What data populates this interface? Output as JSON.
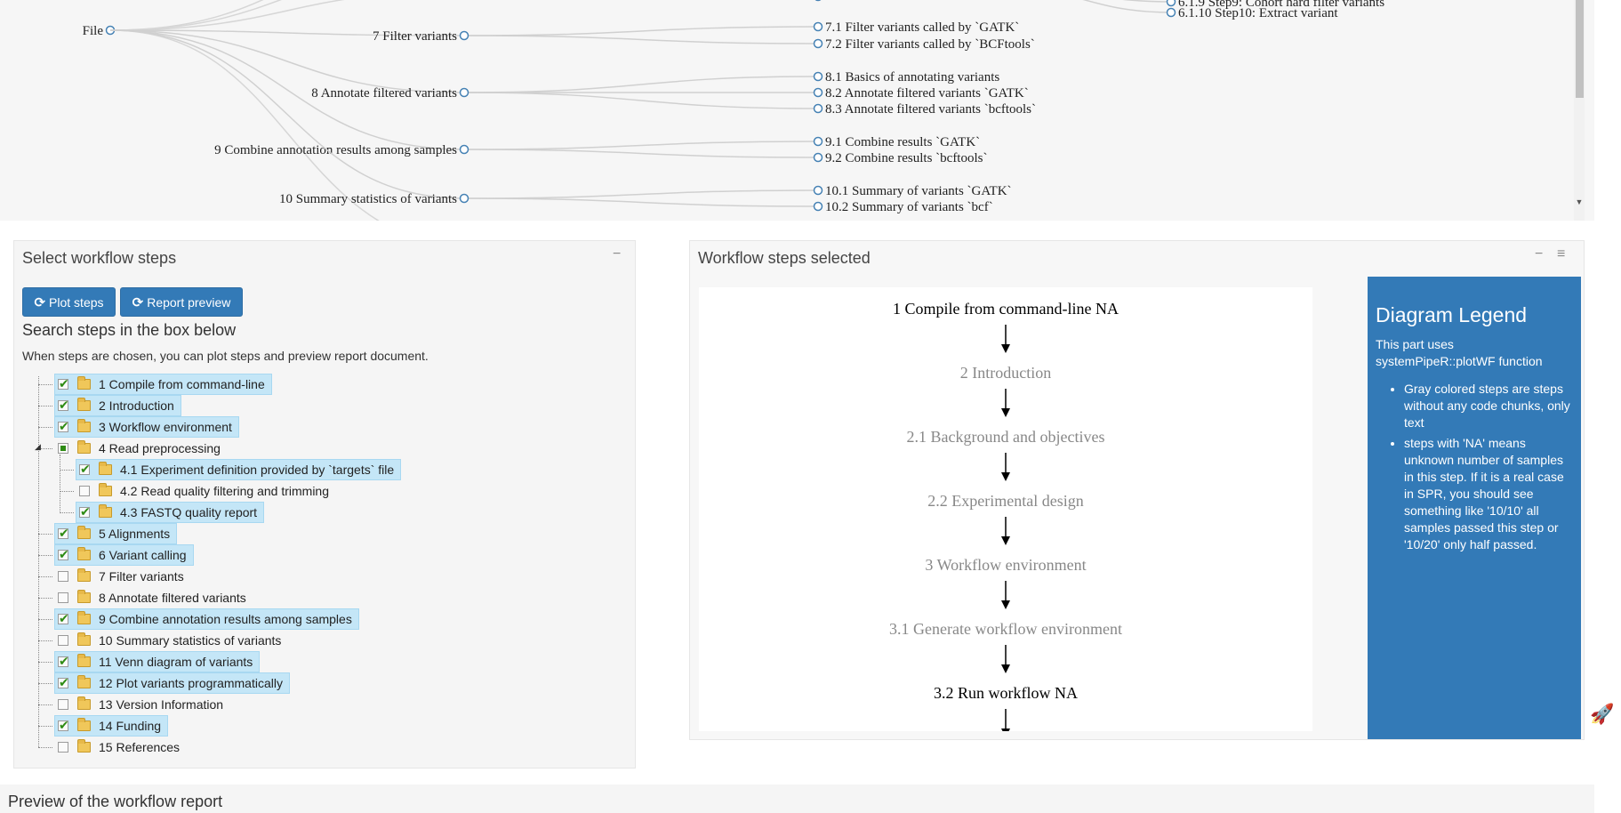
{
  "tree_plot": {
    "root": "File",
    "branches": [
      {
        "label": "7 Filter variants",
        "children": [
          "7.1 Filter variants called by `GATK`",
          "7.2 Filter variants called by `BCFtools`"
        ]
      },
      {
        "label": "8 Annotate filtered variants",
        "children": [
          "8.1 Basics of annotating variants",
          "8.2 Annotate filtered variants `GATK`",
          "8.3 Annotate filtered variants `bcftools`"
        ]
      },
      {
        "label": "9 Combine annotation results among samples",
        "children": [
          "9.1 Combine results `GATK`",
          "9.2 Combine results `bcftools`"
        ]
      },
      {
        "label": "10 Summary statistics of variants",
        "children": [
          "10.1 Summary of variants `GATK`",
          "10.2 Summary of variants `bcf`"
        ]
      }
    ],
    "far_right": [
      "6.1.9 Step9: Cohort hard filter variants",
      "6.1.10 Step10: Extract variant"
    ]
  },
  "left_box": {
    "title": "Select workflow steps",
    "collapse": "−",
    "plot_button": "Plot steps",
    "report_button": "Report preview",
    "heading": "Search steps in the box below",
    "help": "When steps are chosen, you can plot steps and preview report document.",
    "steps": [
      {
        "label": "1 Compile from command-line",
        "checked": true,
        "level": 0
      },
      {
        "label": "2 Introduction",
        "checked": true,
        "level": 0
      },
      {
        "label": "3 Workflow environment",
        "checked": true,
        "level": 0
      },
      {
        "label": "4 Read preprocessing",
        "checked": "partial",
        "level": 0
      },
      {
        "label": "4.1 Experiment definition provided by `targets` file",
        "checked": true,
        "level": 1
      },
      {
        "label": "4.2 Read quality filtering and trimming",
        "checked": false,
        "level": 1
      },
      {
        "label": "4.3 FASTQ quality report",
        "checked": true,
        "level": 1
      },
      {
        "label": "5 Alignments",
        "checked": true,
        "level": 0
      },
      {
        "label": "6 Variant calling",
        "checked": true,
        "level": 0
      },
      {
        "label": "7 Filter variants",
        "checked": false,
        "level": 0
      },
      {
        "label": "8 Annotate filtered variants",
        "checked": false,
        "level": 0
      },
      {
        "label": "9 Combine annotation results among samples",
        "checked": true,
        "level": 0
      },
      {
        "label": "10 Summary statistics of variants",
        "checked": false,
        "level": 0
      },
      {
        "label": "11 Venn diagram of variants",
        "checked": true,
        "level": 0
      },
      {
        "label": "12 Plot variants programmatically",
        "checked": true,
        "level": 0
      },
      {
        "label": "13 Version Information",
        "checked": false,
        "level": 0
      },
      {
        "label": "14 Funding",
        "checked": true,
        "level": 0
      },
      {
        "label": "15 References",
        "checked": false,
        "level": 0
      }
    ]
  },
  "right_box": {
    "title": "Workflow steps selected",
    "collapse": "−",
    "menu": "≡",
    "diagram_nodes": [
      {
        "label": "1 Compile from command-line NA",
        "gray": false
      },
      {
        "label": "2 Introduction",
        "gray": true
      },
      {
        "label": "2.1 Background and objectives",
        "gray": true
      },
      {
        "label": "2.2 Experimental design",
        "gray": true
      },
      {
        "label": "3 Workflow environment",
        "gray": true
      },
      {
        "label": "3.1 Generate workflow environment",
        "gray": true
      },
      {
        "label": "3.2 Run workflow NA",
        "gray": false
      }
    ],
    "legend": {
      "title": "Diagram Legend",
      "intro": "This part uses systemPipeR::plotWF function",
      "items": [
        "Gray colored steps are steps without any code chunks, only text",
        "steps with 'NA' means unknown number of samples in this step. If it is a real case in SPR, you should see something like '10/10' all samples passed this step or '10/20' only half passed."
      ]
    }
  },
  "preview": {
    "title": "Preview of the workflow report"
  },
  "colors": {
    "primary": "#337ab7",
    "highlight": "#c4e6f7",
    "check": "#2e8b14",
    "node_gray": "#888888"
  }
}
